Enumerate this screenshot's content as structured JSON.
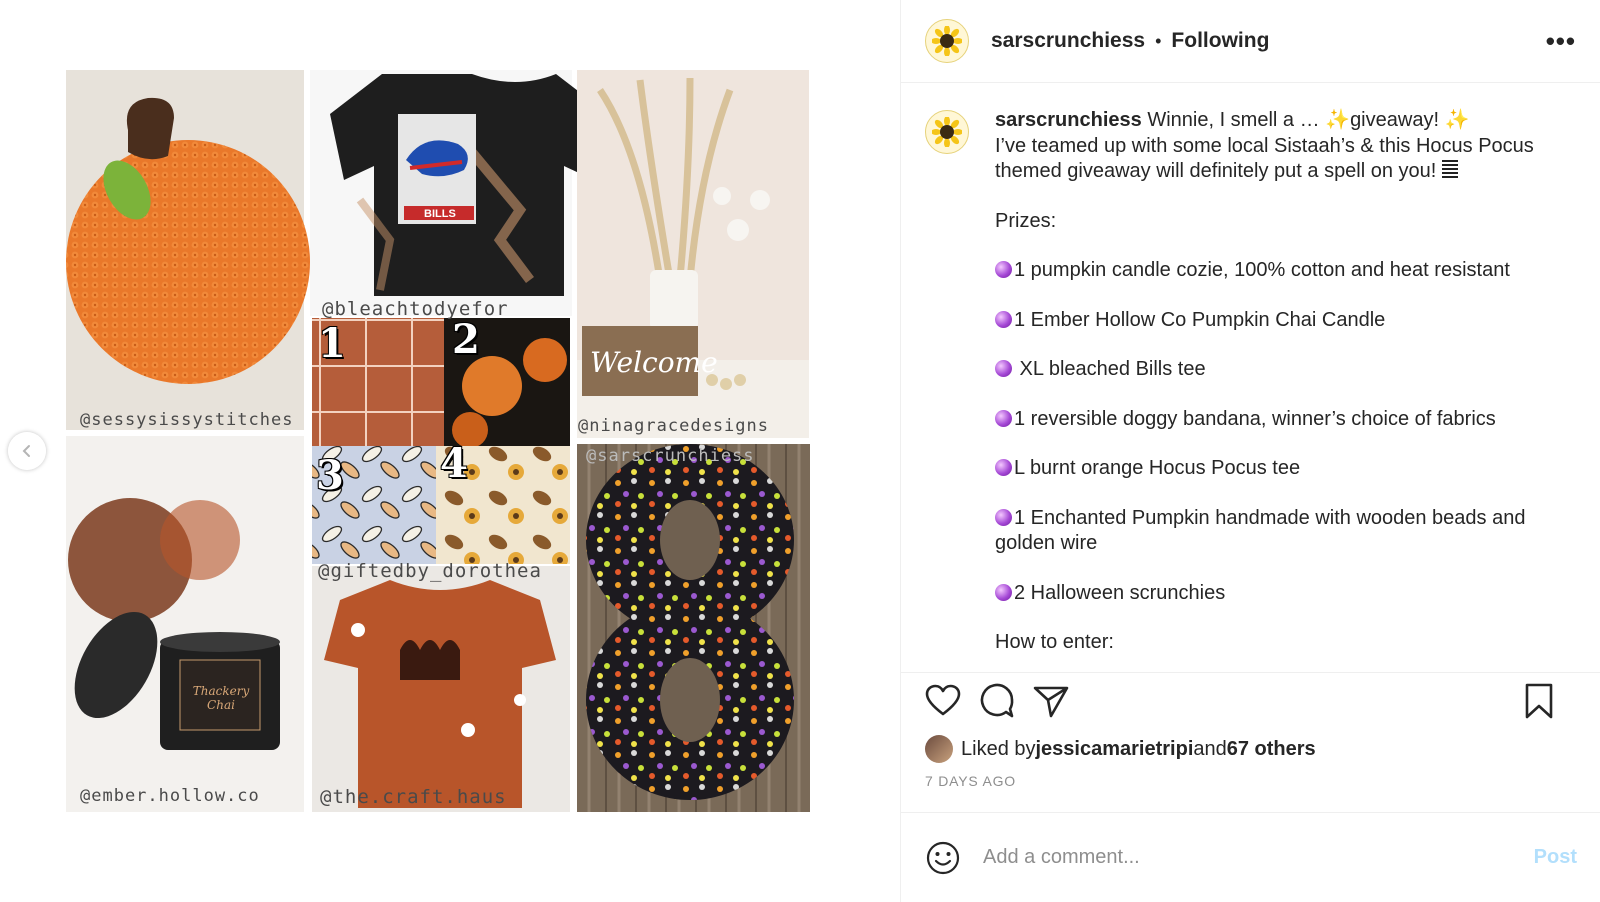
{
  "post": {
    "username": "sarscrunchiess",
    "follow_status": "Following",
    "separator": "•",
    "more_label": "•••"
  },
  "collage": {
    "tags": {
      "tile1": "@sessysissystitches",
      "tile2": "@bleachtodyefor",
      "tile3": "@ninagracedesigns",
      "tile4": "@ember.hollow.co",
      "tile5": "@giftedby_dorothea",
      "tile6": "@sarscrunchiess",
      "tile7": "@the.craft.haus"
    },
    "fabric_numbers": [
      "1",
      "2",
      "3",
      "4"
    ],
    "shirt_text": "BILLS",
    "sign_text": "Welcome",
    "candle_text": "Thackery Chai"
  },
  "caption": {
    "username": "sarscrunchiess",
    "line_intro_a": " Winnie, I smell a … ",
    "line_intro_b": "giveaway! ",
    "line2": "I’ve teamed up with some local Sistaah’s & this Hocus Pocus themed giveaway will definitely put a spell on you! ",
    "prizes_heading": "Prizes:",
    "prizes": [
      "1 pumpkin candle cozie, 100% cotton and heat resistant",
      "1 Ember Hollow Co Pumpkin Chai Candle",
      " XL bleached Bills tee",
      "1 reversible doggy bandana, winner’s choice of fabrics",
      "L burnt orange Hocus Pocus tee",
      "1 Enchanted Pumpkin handmade with wooden beads and golden wire",
      "2 Halloween scrunchies"
    ],
    "how_to_enter": "How to enter:",
    "sparkle": "✨"
  },
  "likes": {
    "prefix": "Liked by ",
    "user": "jessicamarietripi",
    "middle": " and ",
    "others": "67 others"
  },
  "time_ago": "7 DAYS AGO",
  "comment": {
    "placeholder": "Add a comment...",
    "post_label": "Post"
  },
  "icons": [
    "chevron-left-icon",
    "sunflower-avatar-icon",
    "more-icon",
    "heart-icon",
    "comment-icon",
    "share-icon",
    "bookmark-icon",
    "emoji-icon",
    "crystal-ball-icon"
  ]
}
